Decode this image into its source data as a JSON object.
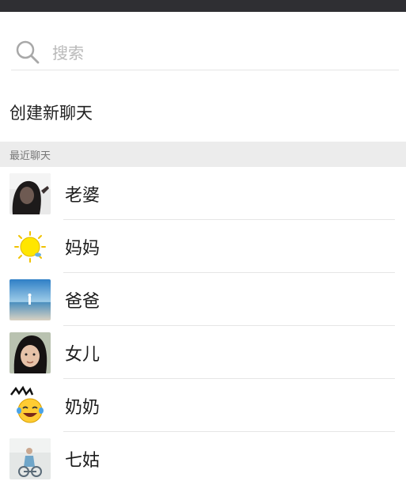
{
  "search": {
    "placeholder": "搜索",
    "icon": "search-icon"
  },
  "actions": {
    "new_chat_label": "创建新聊天"
  },
  "recent": {
    "header": "最近聊天",
    "contacts": [
      {
        "name": "老婆",
        "avatar": "photo-avatar"
      },
      {
        "name": "妈妈",
        "avatar": "sun-emoji-avatar"
      },
      {
        "name": "爸爸",
        "avatar": "beach-avatar"
      },
      {
        "name": "女儿",
        "avatar": "photo-avatar"
      },
      {
        "name": "奶奶",
        "avatar": "laughing-emoji-avatar"
      },
      {
        "name": "七姑",
        "avatar": "photo-avatar"
      }
    ]
  },
  "colors": {
    "topbar": "#2f2f33",
    "section_bg": "#ececec",
    "placeholder": "#b9b9b9"
  }
}
